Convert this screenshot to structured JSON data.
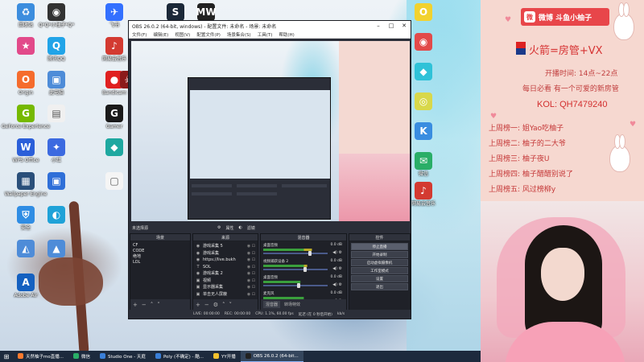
{
  "desktop": {
    "icons": [
      {
        "label": "回收站",
        "color": "#3c8dde",
        "glyph": "♻"
      },
      {
        "label": "Q*Q*小柚子*Q*",
        "color": "#333333",
        "glyph": "◉"
      },
      {
        "label": "飞书",
        "color": "#3370ff",
        "glyph": "✈"
      },
      {
        "label": "Steam",
        "color": "#1b2838",
        "glyph": "S"
      },
      {
        "label": "MW",
        "color": "#222222",
        "glyph": "MW"
      },
      {
        "label": "",
        "color": "#e24a8a",
        "glyph": "★"
      },
      {
        "label": "腾讯QQ",
        "color": "#21a4e8",
        "glyph": "Q"
      },
      {
        "label": "网易云音乐",
        "color": "#d33a31",
        "glyph": "♪"
      },
      {
        "label": "Origin",
        "color": "#f56c2d",
        "glyph": "O"
      },
      {
        "label": "此电脑",
        "color": "#4e8cd8",
        "glyph": "▣"
      },
      {
        "label": "Bandicam",
        "color": "#e02020",
        "glyph": "●"
      },
      {
        "label": "",
        "color": "#8b1a1a",
        "glyph": "☠"
      },
      {
        "label": "GeForce Experience",
        "color": "#76b900",
        "glyph": "G"
      },
      {
        "label": "",
        "color": "#f0f0f0",
        "glyph": "▤"
      },
      {
        "label": "Gamer",
        "color": "#1a1a1a",
        "glyph": "G"
      },
      {
        "label": "WPS Office",
        "color": "#2b5fd9",
        "glyph": "W"
      },
      {
        "label": "小红",
        "color": "#3c6ae0",
        "glyph": "✦"
      },
      {
        "label": "",
        "color": "#1ea8a0",
        "glyph": "◆"
      },
      {
        "label": "Wallpaper Engine",
        "color": "#2a4f7a",
        "glyph": "▦"
      },
      {
        "label": "",
        "color": "#2f6fd8",
        "glyph": "▣"
      },
      {
        "label": "",
        "color": "#f5f5f5",
        "glyph": "▢"
      },
      {
        "label": "安全",
        "color": "#2f8de4",
        "glyph": "⛨"
      },
      {
        "label": "",
        "color": "#1fa2d8",
        "glyph": "◐"
      },
      {
        "label": "",
        "color": "#4e8cd8",
        "glyph": "◭"
      },
      {
        "label": "",
        "color": "#4e8cd8",
        "glyph": "▲"
      },
      {
        "label": "Adobe Air",
        "color": "#1460c0",
        "glyph": "A"
      }
    ],
    "right_icons": [
      {
        "label": "",
        "color": "#f2d22e",
        "glyph": "O"
      },
      {
        "label": "",
        "color": "#e24a4a",
        "glyph": "◉"
      },
      {
        "label": "",
        "color": "#2fc2d8",
        "glyph": "◆"
      },
      {
        "label": "",
        "color": "#d8d84a",
        "glyph": "◎"
      },
      {
        "label": "",
        "color": "#3a8de0",
        "glyph": "K"
      },
      {
        "label": "微信",
        "color": "#2aae67",
        "glyph": "✉"
      },
      {
        "label": "网易云音乐",
        "color": "#d33a31",
        "glyph": "♪"
      }
    ]
  },
  "obs": {
    "title": "OBS 26.0.2 (64-bit, windows) - 配置文件: 未命名 - 场景: 未命名",
    "menu": [
      "文件(F)",
      "编辑(E)",
      "视图(V)",
      "配置文件(P)",
      "场景集合(S)",
      "工具(T)",
      "帮助(H)"
    ],
    "scene_tabs": [
      "未选择源",
      "属性",
      "滤镜"
    ],
    "docks": {
      "scenes_header": "场景",
      "sources_header": "来源",
      "mixer_header": "混音器",
      "controls_header": "控件"
    },
    "scenes": [
      "CF",
      "CODE",
      "绝地",
      "LOL"
    ],
    "sources": [
      {
        "icon": "◉",
        "name": "游戏采集 5"
      },
      {
        "icon": "◉",
        "name": "游戏采集"
      },
      {
        "icon": "◉",
        "name": "https://live.bukh"
      },
      {
        "icon": "T",
        "name": "SOL"
      },
      {
        "icon": "◉",
        "name": "游戏采集 2"
      },
      {
        "icon": "▣",
        "name": "视频"
      },
      {
        "icon": "▣",
        "name": "显示器采集"
      },
      {
        "icon": "▣",
        "name": "单击无人屏蔽"
      }
    ],
    "mixer": [
      {
        "name": "桌面音频",
        "db": "0.0 dB",
        "level": 0.72
      },
      {
        "name": "视频捕获设备 2",
        "db": "0.0 dB",
        "level": 0.65
      },
      {
        "name": "桌面音频",
        "db": "0.0 dB",
        "level": 0.55
      },
      {
        "name": "麦克风",
        "db": "0.0 dB",
        "level": 0.6
      }
    ],
    "mixer_tabs": [
      "混音器",
      "转场特效"
    ],
    "controls": [
      "停止直播",
      "开始录制",
      "启动虚拟摄像机",
      "工作室模式",
      "设置",
      "退出"
    ],
    "status": {
      "live": "LIVE: 00:00:00",
      "rec": "REC: 00:00:00",
      "cpu": "CPU: 1.1%, 60.00 fps",
      "dropped": "延迟 (在 0 秒后开始)",
      "kbps": "kb/s"
    }
  },
  "panel": {
    "weibo": "微博 斗鱼小柚子",
    "weibo_icon": "微",
    "title": "火箭=房管+VX",
    "time": "开播时间: 14点~22点",
    "daily": "每日必看 有一个可爱的新房管",
    "kol": "KOL: QH7479240",
    "ranks": [
      "上周榜一: 姐Yao吃柚子",
      "上周榜二: 柚子的二大爷",
      "上周榜三: 柚子夜U",
      "上周榜四: 柚子醋醋别说了",
      "上周榜五: 风过榜柳y"
    ],
    "accent": "#c53838",
    "bg": "#f6d8d0"
  },
  "taskbar": {
    "items": [
      {
        "label": "天然柚子mo直播...",
        "color": "#ff7a2e",
        "active": false
      },
      {
        "label": "微信",
        "color": "#2aae67",
        "active": false
      },
      {
        "label": "Studio One - 天庭",
        "color": "#3a7fd8",
        "active": false
      },
      {
        "label": "Poly (不确定) - 酷...",
        "color": "#3a7fd8",
        "active": false
      },
      {
        "label": "YY开播",
        "color": "#f2c12e",
        "active": false
      },
      {
        "label": "OBS 26.0.2 (64-bit...",
        "color": "#222222",
        "active": true
      }
    ]
  }
}
